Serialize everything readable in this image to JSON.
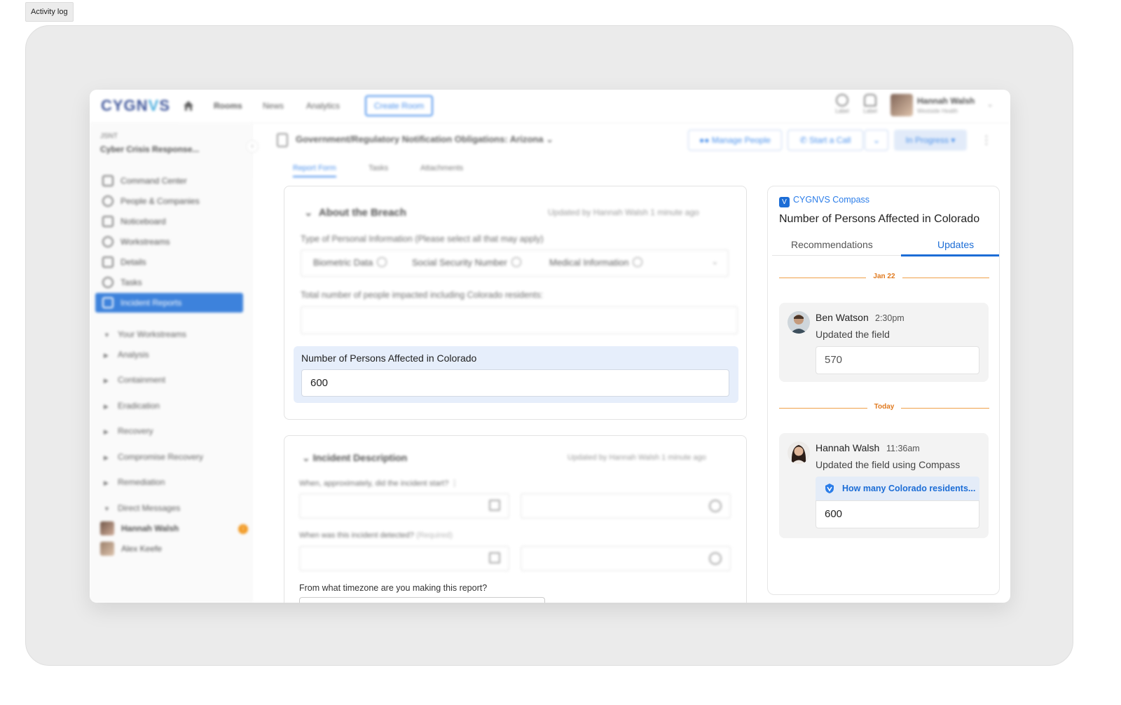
{
  "activity_tab": "Activity log",
  "topnav": {
    "logo_left": "CYGN",
    "logo_mid": "V",
    "logo_right": "S",
    "nav": [
      "Rooms",
      "News",
      "Analytics"
    ],
    "create_room": "Create Room",
    "icon_labels": [
      "Label",
      "Label"
    ],
    "user_name": "Hannah Walsh",
    "user_org": "Westside Health"
  },
  "sidebar": {
    "ws_code": "JSNT",
    "ws_name": "Cyber Crisis Response...",
    "items": [
      "Command Center",
      "People & Companies",
      "Noticeboard",
      "Workstreams",
      "Details",
      "Tasks",
      "Incident Reports"
    ],
    "section_workstreams": "Your Workstreams",
    "workstreams": [
      "Analysis",
      "Containment",
      "Eradication",
      "Recovery",
      "Compromise Recovery",
      "Remediation"
    ],
    "section_dms": "Direct Messages",
    "dms": [
      "Hannah Walsh",
      "Alex Keefe"
    ],
    "dm_badge": "!"
  },
  "header": {
    "room_title": "Government/Regulatory Notification Obligations: Arizona",
    "manage_people": "Manage People",
    "start_call": "Start a Call",
    "status": "In Progress",
    "tabs": [
      "Report Form",
      "Tasks",
      "Attachments"
    ]
  },
  "breach": {
    "title": "About the Breach",
    "updated": "Updated by Hannah Walsh 1 minute ago",
    "type_label": "Type of Personal Information (Please select all that may apply)",
    "chips": [
      "Biometric Data",
      "Social Security Number",
      "Medical Information"
    ],
    "total_label": "Total number of people impacted including Colorado residents:",
    "colorado_label": "Number of Persons Affected in Colorado",
    "colorado_value": "600"
  },
  "incident": {
    "title": "Incident Description",
    "updated": "Updated by Hannah Walsh 1 minute ago",
    "start_label": "When, approximately, did the incident start?",
    "detected_label": "When was this incident detected?",
    "detected_required": "(Required)",
    "timezone_label": "From what timezone are you making this report?"
  },
  "compass": {
    "brand": "CYGNVS Compass",
    "brand_icon": "V",
    "title": "Number of Persons Affected in Colorado",
    "tab_recommendations": "Recommendations",
    "tab_updates": "Updates",
    "updates": [
      {
        "date": "Jan 22",
        "name": "Ben Watson",
        "time": "2:30pm",
        "desc": "Updated the field",
        "value": "570"
      },
      {
        "date": "Today",
        "name": "Hannah Walsh",
        "time": "11:36am",
        "desc": "Updated the field using Compass",
        "question": "How many Colorado residents...",
        "value": "600"
      }
    ]
  },
  "colors": {
    "accent": "#1c6dd6",
    "date_separator": "#e07a1f",
    "highlight_bg": "#e6eefb"
  }
}
